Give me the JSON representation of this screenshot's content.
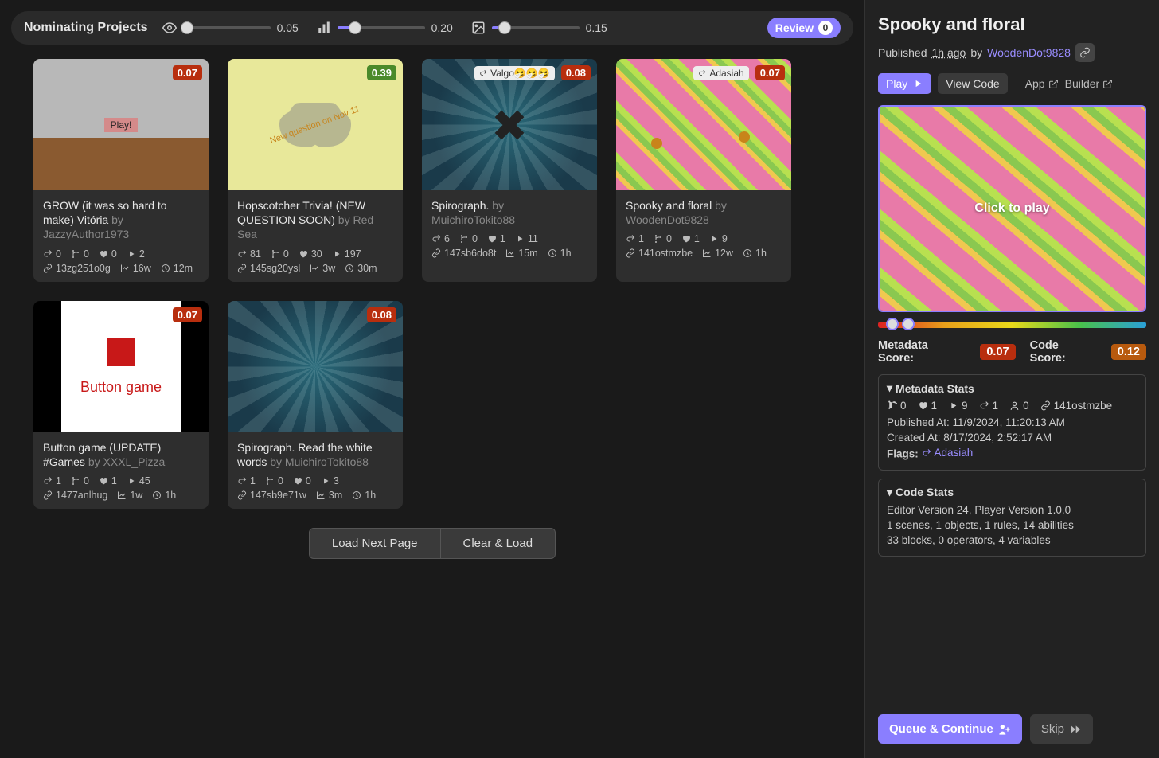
{
  "toolbar": {
    "title": "Nominating Projects",
    "sliders": [
      {
        "icon": "eye",
        "value": "0.05",
        "fill_pct": 5
      },
      {
        "icon": "chart",
        "value": "0.20",
        "fill_pct": 20
      },
      {
        "icon": "image",
        "value": "0.15",
        "fill_pct": 15
      }
    ],
    "review_label": "Review",
    "review_count": "0"
  },
  "cards": [
    {
      "title": "GROW (it was so hard to make) Vitória",
      "by_prefix": "by ",
      "author": "JazzyAuthor1973",
      "score": "0.07",
      "score_class": "score-red",
      "remix": "0",
      "branches": "0",
      "likes": "0",
      "plays": "2",
      "id": "13zg251o0g",
      "age": "16w",
      "time": "12m",
      "thumb_class": "thumb-0"
    },
    {
      "title": "Hopscotcher Trivia! (NEW QUESTION SOON)",
      "by_prefix": "by ",
      "author": "Red Sea",
      "score": "0.39",
      "score_class": "score-green",
      "remix": "81",
      "branches": "0",
      "likes": "30",
      "plays": "197",
      "id": "145sg20ysl",
      "age": "3w",
      "time": "30m",
      "thumb_class": "thumb-1"
    },
    {
      "title": "Spirograph.",
      "by_prefix": "by ",
      "author": "MuichiroTokito88",
      "score": "0.08",
      "score_class": "score-red",
      "badge_user": "Valgo",
      "badge_emoji": "🤧🤧🤧",
      "remix": "6",
      "branches": "0",
      "likes": "1",
      "plays": "11",
      "id": "147sb6do8t",
      "age": "15m",
      "time": "1h",
      "thumb_class": "thumb-2"
    },
    {
      "title": "Spooky and floral",
      "by_prefix": "by ",
      "author": "WoodenDot9828",
      "score": "0.07",
      "score_class": "score-red",
      "badge_user": "Adasiah",
      "badge_emoji": "",
      "remix": "1",
      "branches": "0",
      "likes": "1",
      "plays": "9",
      "id": "141ostmzbe",
      "age": "12w",
      "time": "1h",
      "thumb_class": "thumb-3"
    },
    {
      "title": "Button game (UPDATE) #Games",
      "by_prefix": "by ",
      "author": "XXXL_Pizza",
      "score": "0.07",
      "score_class": "score-red",
      "remix": "1",
      "branches": "0",
      "likes": "1",
      "plays": "45",
      "id": "1477anlhug",
      "age": "1w",
      "time": "1h",
      "thumb_class": "thumb-4"
    },
    {
      "title": "Spirograph. Read the white words",
      "by_prefix": "by ",
      "author": "MuichiroTokito88",
      "score": "0.08",
      "score_class": "score-red",
      "remix": "1",
      "branches": "0",
      "likes": "0",
      "plays": "3",
      "id": "147sb9e71w",
      "age": "3m",
      "time": "1h",
      "thumb_class": "thumb-5"
    }
  ],
  "pagination": {
    "load_next": "Load Next Page",
    "clear_load": "Clear & Load"
  },
  "side": {
    "title": "Spooky and floral",
    "published_prefix": "Published ",
    "time": "1h ago",
    "by": " by ",
    "author": "WoodenDot9828",
    "tab_play": "Play",
    "tab_code": "View Code",
    "link_app": "App",
    "link_builder": "Builder",
    "preview_text": "Click to play",
    "meta_score_label": "Metadata Score:",
    "meta_score": "0.07",
    "code_score_label": "Code Score:",
    "code_score": "0.12",
    "meta_header": "Metadata Stats",
    "meta_stats": {
      "branches": "0",
      "likes": "1",
      "plays": "9",
      "remix": "1",
      "views": "0",
      "id": "141ostmzbe"
    },
    "published_at": "Published At: 11/9/2024, 11:20:13 AM",
    "created_at": "Created At: 8/17/2024, 2:52:17 AM",
    "flags_label": "Flags:",
    "flags_user": "Adasiah",
    "code_header": "Code Stats",
    "code_line1": "Editor Version 24, Player Version 1.0.0",
    "code_line2": "1 scenes, 1 objects, 1 rules, 14 abilities",
    "code_line3": "33 blocks, 0 operators, 4 variables",
    "queue_btn": "Queue & Continue",
    "skip_btn": "Skip"
  },
  "thumb_text": {
    "play": "Play!",
    "diag": "New question on Nov 11",
    "button_game": "Button game"
  }
}
